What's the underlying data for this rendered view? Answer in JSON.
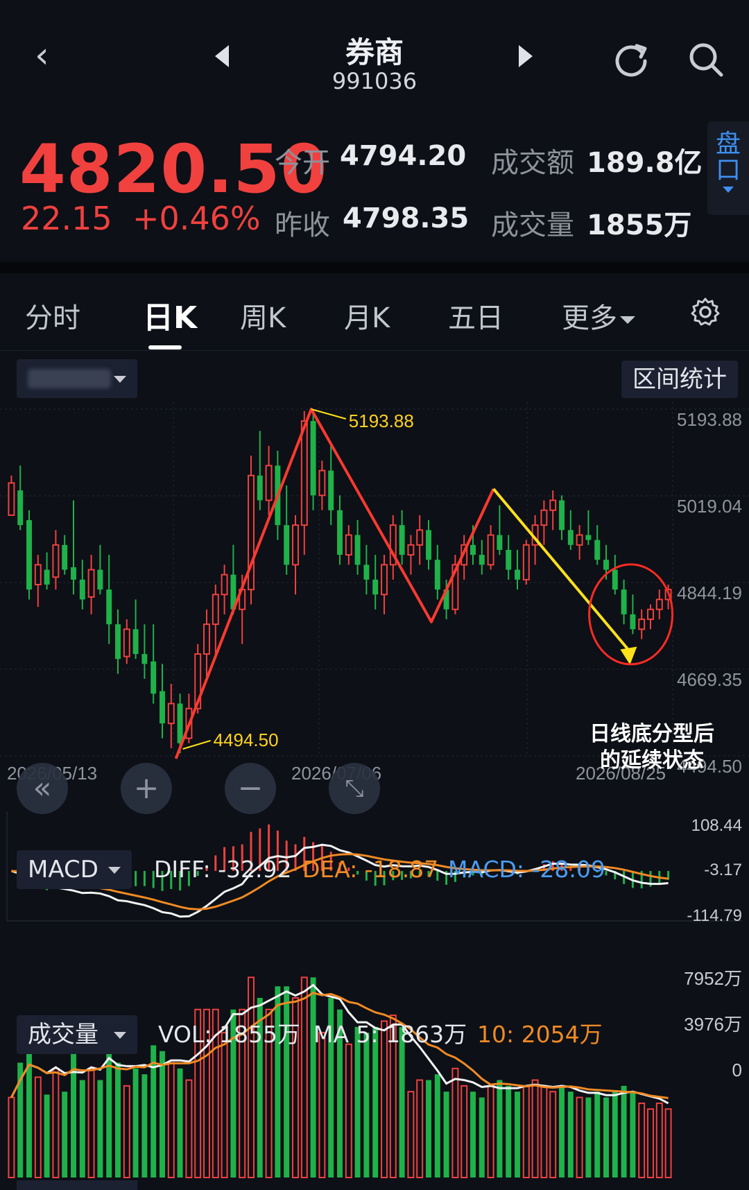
{
  "header": {
    "title": "券商",
    "code": "991036"
  },
  "quote": {
    "price": "4820.50",
    "change": "22.15",
    "change_pct": "+0.46%",
    "open_label": "今开",
    "open_value": "4794.20",
    "prev_close_label": "昨收",
    "prev_close_value": "4798.35",
    "amount_label": "成交额",
    "amount_value": "189.8亿",
    "volume_label": "成交量",
    "volume_value": "1855万",
    "pankou_label": "盘口",
    "up_color": "#f0413f",
    "down_color": "#1fb24a"
  },
  "tabs": [
    {
      "label": "分时"
    },
    {
      "label": "日K"
    },
    {
      "label": "周K"
    },
    {
      "label": "月K"
    },
    {
      "label": "五日"
    },
    {
      "label": "更多"
    }
  ],
  "toolbar": {
    "range_stats": "区间统计"
  },
  "chart_data": [
    {
      "type": "candlestick",
      "price_axis": [
        "5193.88",
        "5019.04",
        "4844.19",
        "4669.35",
        "4494.50"
      ],
      "ylim": [
        4494.5,
        5193.88
      ],
      "date_ticks": [
        "2026/05/13",
        "2026/07/06",
        "2026/08/25"
      ],
      "marked_high": "5193.88",
      "marked_low": "4494.50",
      "annotation": "日线底分型后\n的延续状态",
      "candles": [
        [
          4980,
          5060,
          4990,
          5045
        ],
        [
          5030,
          5080,
          4950,
          4960
        ],
        [
          4970,
          4990,
          4810,
          4830
        ],
        [
          4840,
          4900,
          4795,
          4880
        ],
        [
          4870,
          4905,
          4830,
          4840
        ],
        [
          4855,
          4950,
          4830,
          4920
        ],
        [
          4920,
          4940,
          4860,
          4870
        ],
        [
          4875,
          5010,
          4820,
          4850
        ],
        [
          4850,
          4890,
          4790,
          4810
        ],
        [
          4815,
          4900,
          4780,
          4870
        ],
        [
          4870,
          4920,
          4820,
          4830
        ],
        [
          4830,
          4900,
          4720,
          4760
        ],
        [
          4760,
          4790,
          4660,
          4690
        ],
        [
          4695,
          4770,
          4680,
          4750
        ],
        [
          4750,
          4810,
          4690,
          4700
        ],
        [
          4700,
          4760,
          4650,
          4680
        ],
        [
          4685,
          4760,
          4600,
          4620
        ],
        [
          4625,
          4680,
          4530,
          4560
        ],
        [
          4560,
          4640,
          4510,
          4600
        ],
        [
          4600,
          4620,
          4500,
          4520
        ],
        [
          4530,
          4620,
          4520,
          4590
        ],
        [
          4590,
          4720,
          4580,
          4700
        ],
        [
          4700,
          4790,
          4650,
          4760
        ],
        [
          4760,
          4840,
          4700,
          4820
        ],
        [
          4820,
          4880,
          4780,
          4860
        ],
        [
          4860,
          4920,
          4780,
          4790
        ],
        [
          4790,
          4860,
          4720,
          4830
        ],
        [
          4830,
          5100,
          4800,
          5060
        ],
        [
          5060,
          5150,
          4990,
          5010
        ],
        [
          5010,
          5120,
          4980,
          5080
        ],
        [
          5080,
          5110,
          4930,
          4960
        ],
        [
          4960,
          5040,
          4860,
          4880
        ],
        [
          4880,
          4980,
          4820,
          4960
        ],
        [
          4960,
          5190,
          4900,
          5170
        ],
        [
          5170,
          5193,
          4990,
          5020
        ],
        [
          5020,
          5090,
          4990,
          5070
        ],
        [
          5070,
          5120,
          4960,
          4990
        ],
        [
          4990,
          5020,
          4880,
          4900
        ],
        [
          4900,
          4960,
          4880,
          4940
        ],
        [
          4940,
          4970,
          4860,
          4880
        ],
        [
          4880,
          4920,
          4820,
          4850
        ],
        [
          4850,
          4900,
          4790,
          4820
        ],
        [
          4820,
          4900,
          4780,
          4880
        ],
        [
          4880,
          4980,
          4850,
          4960
        ],
        [
          4960,
          4990,
          4880,
          4900
        ],
        [
          4900,
          4940,
          4860,
          4920
        ],
        [
          4920,
          4980,
          4880,
          4950
        ],
        [
          4950,
          4970,
          4870,
          4890
        ],
        [
          4890,
          4920,
          4810,
          4830
        ],
        [
          4830,
          4850,
          4770,
          4790
        ],
        [
          4790,
          4900,
          4780,
          4880
        ],
        [
          4880,
          4940,
          4850,
          4920
        ],
        [
          4920,
          4960,
          4880,
          4900
        ],
        [
          4900,
          4930,
          4860,
          4880
        ],
        [
          4880,
          4960,
          4870,
          4940
        ],
        [
          4940,
          5000,
          4900,
          4910
        ],
        [
          4910,
          4940,
          4850,
          4870
        ],
        [
          4870,
          4910,
          4830,
          4850
        ],
        [
          4850,
          4930,
          4840,
          4920
        ],
        [
          4920,
          4980,
          4880,
          4960
        ],
        [
          4960,
          5010,
          4920,
          4990
        ],
        [
          4990,
          5030,
          4950,
          5010
        ],
        [
          5010,
          5020,
          4930,
          4950
        ],
        [
          4950,
          4990,
          4910,
          4920
        ],
        [
          4920,
          4960,
          4890,
          4940
        ],
        [
          4940,
          4990,
          4920,
          4930
        ],
        [
          4930,
          4960,
          4880,
          4890
        ],
        [
          4890,
          4920,
          4850,
          4870
        ],
        [
          4870,
          4900,
          4820,
          4830
        ],
        [
          4830,
          4850,
          4760,
          4780
        ],
        [
          4780,
          4820,
          4740,
          4750
        ],
        [
          4750,
          4790,
          4730,
          4770
        ],
        [
          4770,
          4800,
          4750,
          4790
        ],
        [
          4790,
          4830,
          4770,
          4810
        ],
        [
          4810,
          4840,
          4790,
          4830
        ]
      ]
    },
    {
      "type": "macd",
      "label": "MACD",
      "diff": "DIFF: -32.92",
      "dea": "DEA: -18.87",
      "macd": "MACD: -28.09",
      "ticks": [
        "108.44",
        "-3.17",
        "-114.79"
      ],
      "ylim": [
        -114.79,
        108.44
      ]
    },
    {
      "type": "volume",
      "label": "成交量",
      "vol": "VOL: 1855万",
      "ma5": "MA 5: 1863万",
      "ma10": "10: 2054万",
      "ticks": [
        "7952万",
        "3976万",
        "0"
      ],
      "ylim": [
        0,
        7952
      ]
    }
  ]
}
